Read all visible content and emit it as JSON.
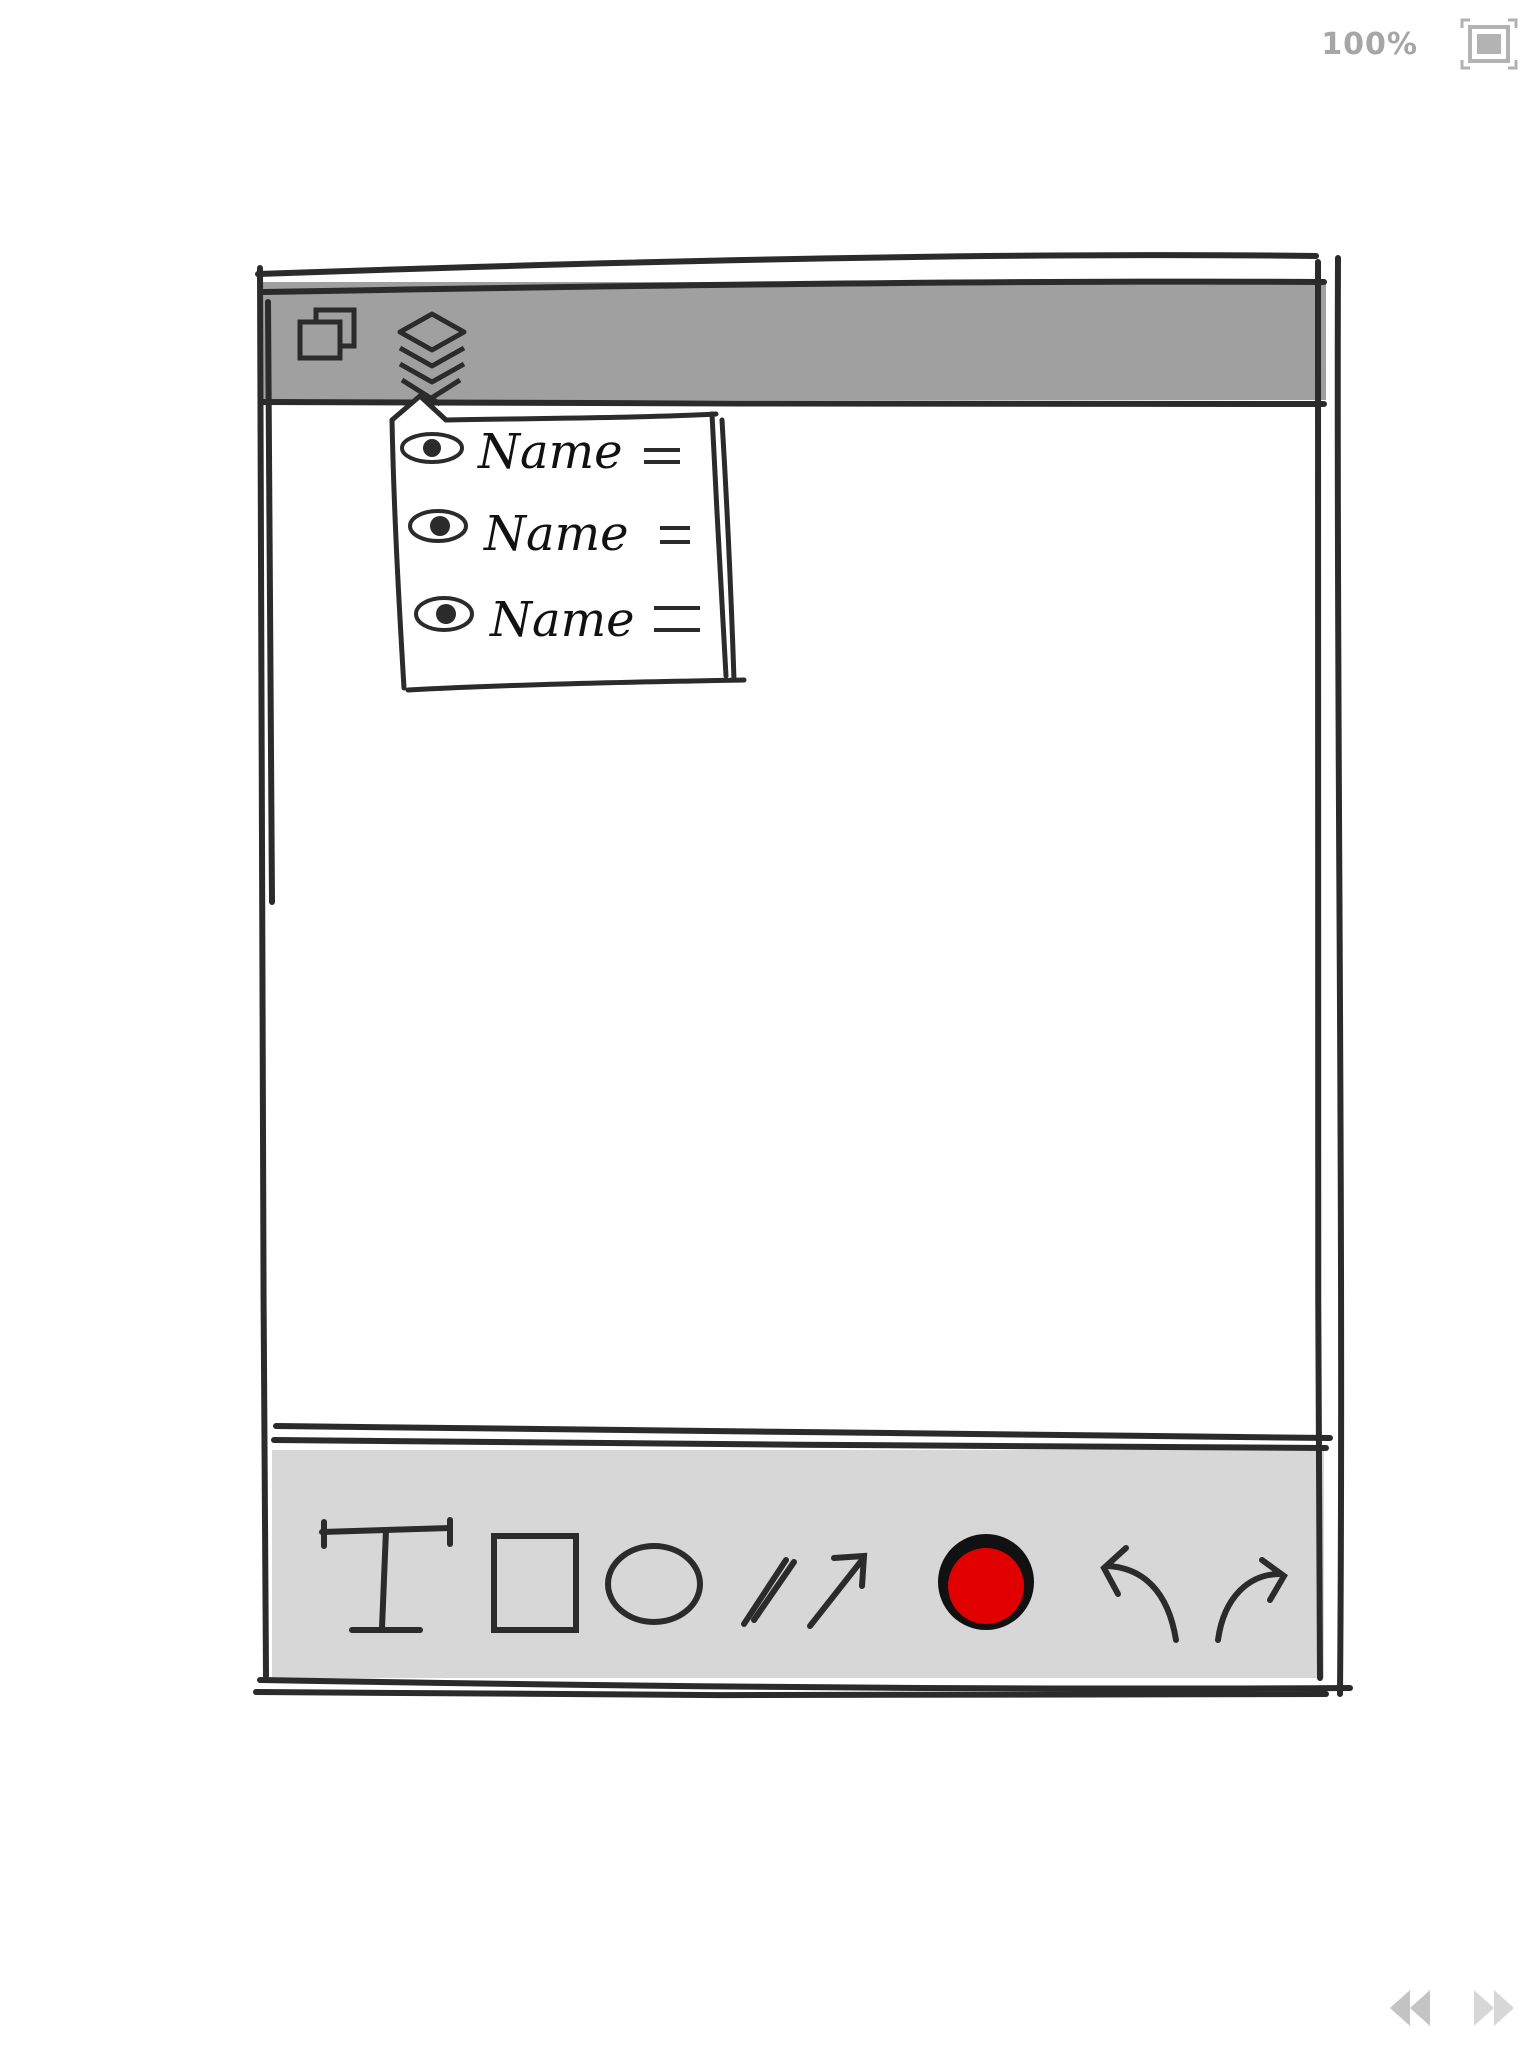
{
  "header": {
    "zoom_label": "100%",
    "fullscreen_icon": "fit-screen-icon"
  },
  "toolbar_top": {
    "icons": [
      "copy-icon",
      "layers-icon"
    ]
  },
  "layers_panel": {
    "items": [
      {
        "label": "Name",
        "icon": "eye-icon",
        "handle": "drag-handle-icon"
      },
      {
        "label": "Name",
        "icon": "eye-icon",
        "handle": "drag-handle-icon"
      },
      {
        "label": "Name",
        "icon": "eye-icon",
        "handle": "drag-handle-icon"
      }
    ]
  },
  "toolbar_bottom": {
    "tools": [
      "text-tool-icon",
      "rectangle-tool-icon",
      "ellipse-tool-icon",
      "pencil-tool-icon",
      "arrow-tool-icon",
      "color-picker-icon",
      "undo-icon",
      "redo-icon"
    ],
    "active_color": "#e00000"
  },
  "pager": {
    "icons": [
      "previous-icon",
      "next-icon"
    ]
  }
}
